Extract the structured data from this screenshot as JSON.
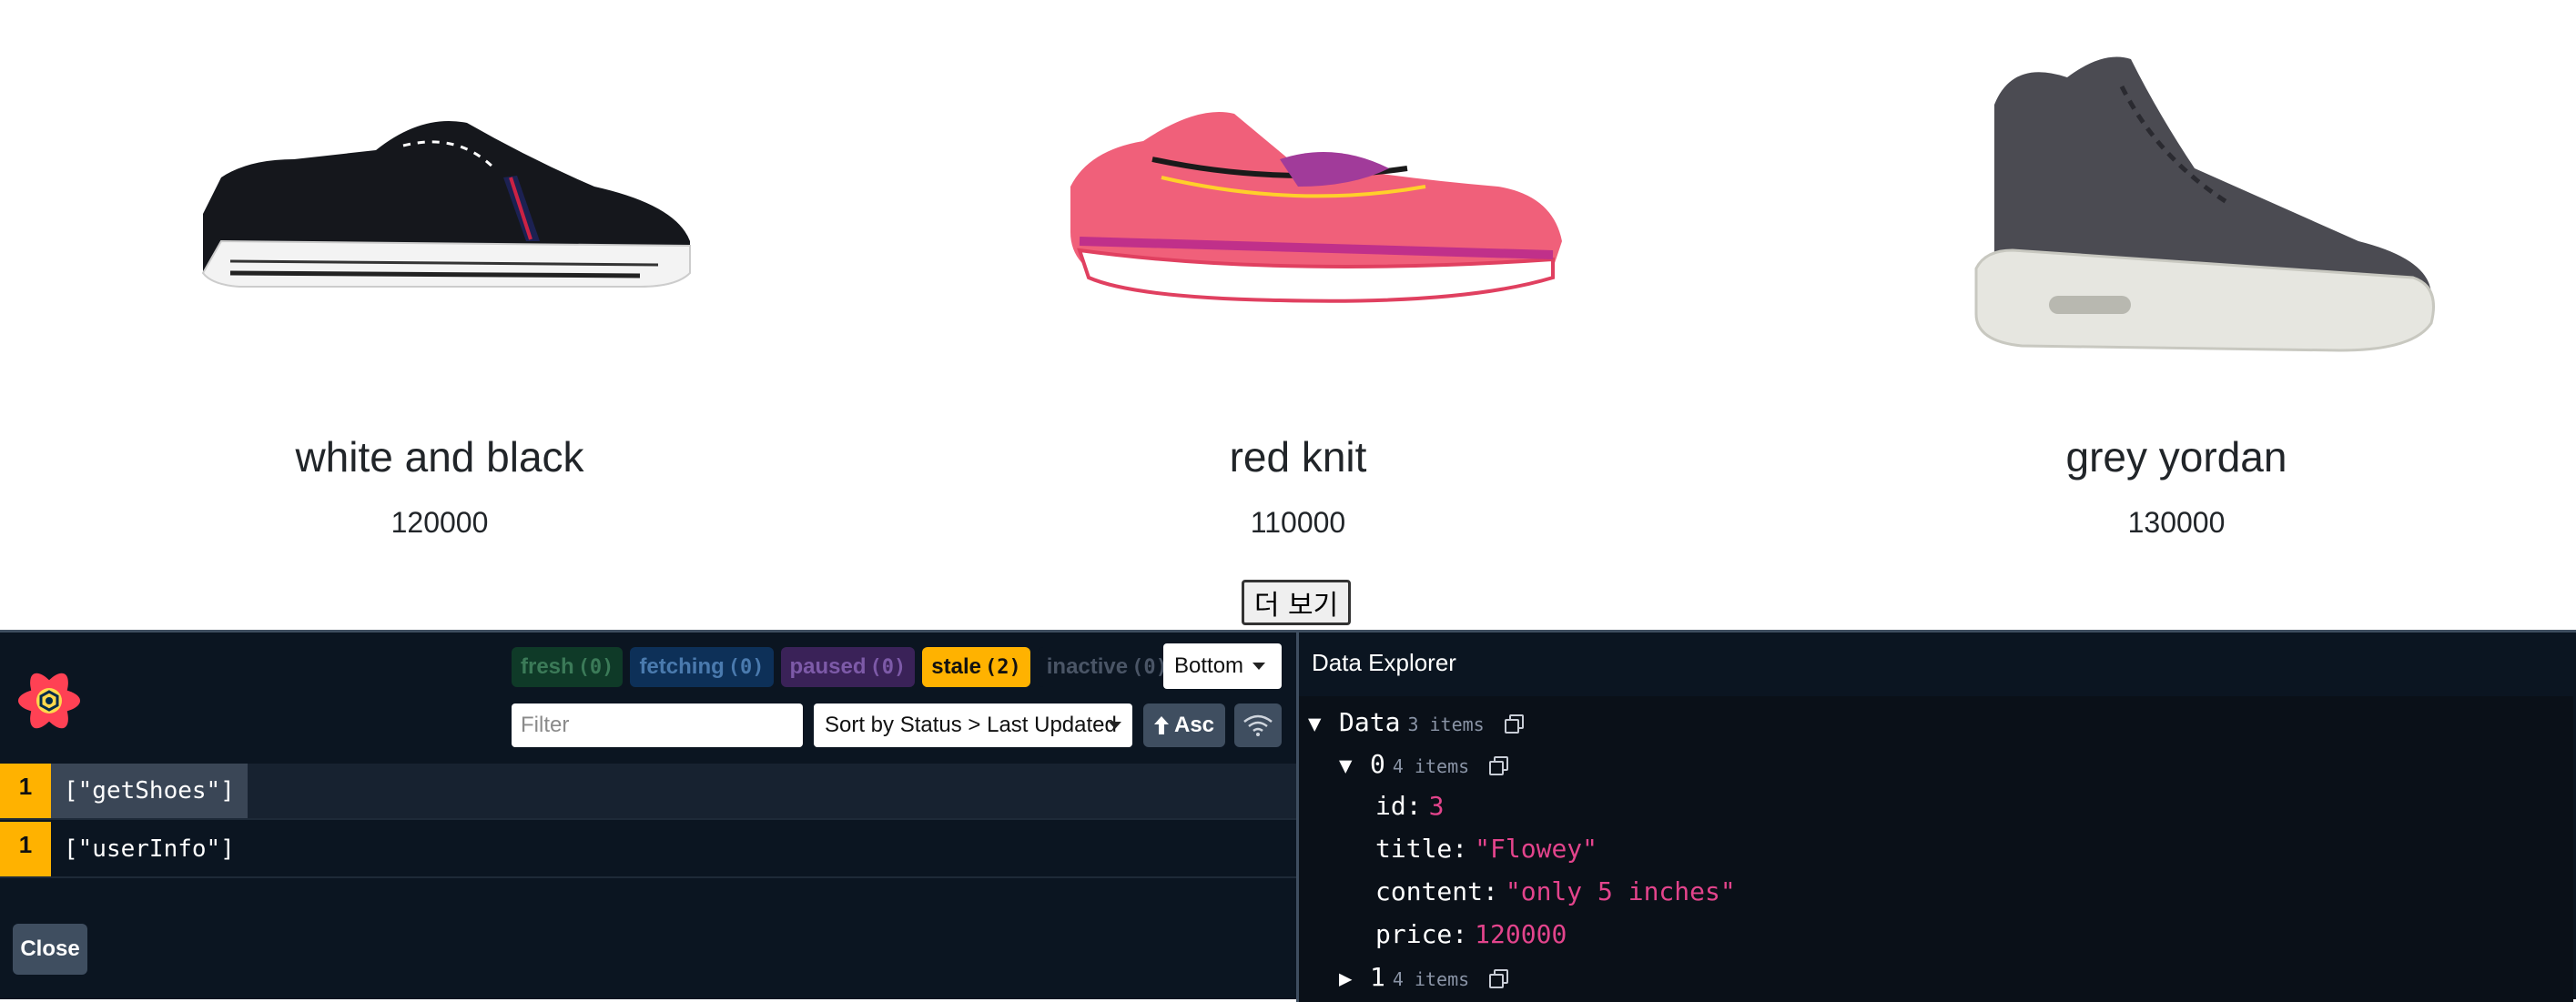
{
  "products": [
    {
      "name": "white and black",
      "price": "120000"
    },
    {
      "name": "red knit",
      "price": "110000"
    },
    {
      "name": "grey yordan",
      "price": "130000"
    }
  ],
  "more_button": "더 보기",
  "devtools": {
    "badges": [
      {
        "label": "fresh",
        "count": "(0)"
      },
      {
        "label": "fetching",
        "count": "(0)"
      },
      {
        "label": "paused",
        "count": "(0)"
      },
      {
        "label": "stale",
        "count": "(2)"
      },
      {
        "label": "inactive",
        "count": "(0)"
      }
    ],
    "position_select": "Bottom",
    "filter_placeholder": "Filter",
    "sort_select": "Sort by Status > Last Updated",
    "asc_label": "Asc",
    "queries": [
      {
        "count": "1",
        "key": "[\"getShoes\"]"
      },
      {
        "count": "1",
        "key": "[\"userInfo\"]"
      }
    ],
    "close_label": "Close",
    "explorer": {
      "title": "Data Explorer",
      "root_label": "Data",
      "root_count": "3 items",
      "item0_label": "0",
      "item0_count": "4 items",
      "fields": [
        {
          "key": "id:",
          "value": "3"
        },
        {
          "key": "title:",
          "value": "\"Flowey\""
        },
        {
          "key": "content:",
          "value": "\"only 5 inches\""
        },
        {
          "key": "price:",
          "value": "120000"
        }
      ],
      "item1_label": "1",
      "item1_count": "4 items"
    }
  },
  "colors": {
    "panel_bg": "#0b1521",
    "stale": "#ffb200",
    "value_pink": "#e3448c"
  }
}
